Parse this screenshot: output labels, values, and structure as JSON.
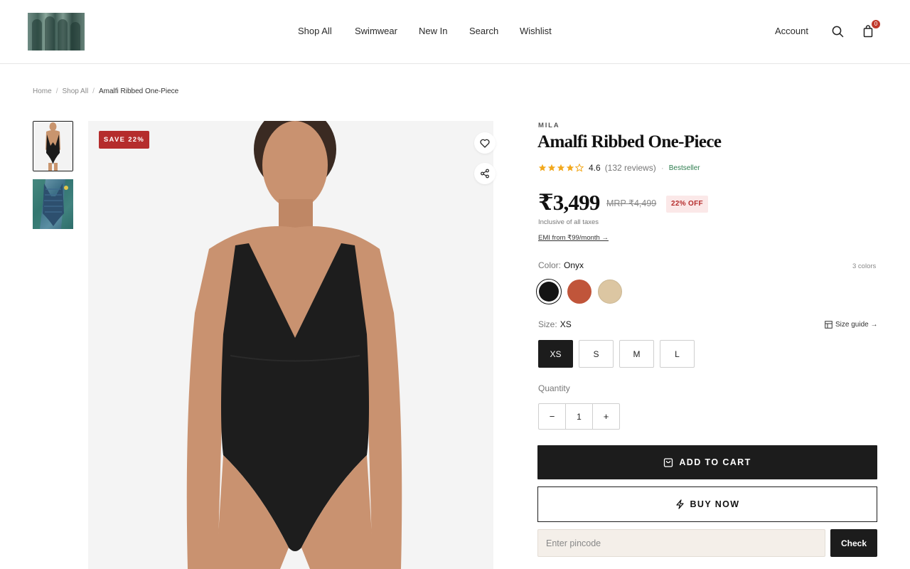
{
  "header": {
    "logo_icon": "swimwear-collection-logo",
    "nav": [
      "Shop All",
      "Swimwear",
      "New In",
      "Search",
      "Wishlist"
    ],
    "account_label": "Account",
    "search_icon": "search-icon",
    "cart_icon": "shopping-bag-icon",
    "cart_count": "0"
  },
  "breadcrumb": {
    "items": [
      "Home",
      "Shop All",
      "Amalfi Ribbed One-Piece"
    ],
    "separator": "/"
  },
  "gallery": {
    "thumbnails": [
      "black one-piece swimsuit front view",
      "blue one-piece swimsuit flat lay"
    ],
    "save_badge": "SAVE 22%",
    "wishlist_icon": "heart-icon",
    "share_icon": "share-icon"
  },
  "product": {
    "brand": "MILA",
    "title": "Amalfi Ribbed One-Piece",
    "rating": 4.6,
    "rating_value": "4.6",
    "reviews": "(132 reviews)",
    "tag": "Bestseller",
    "price": "₹3,499",
    "mrp": "MRP ₹4,499",
    "discount": "22% OFF",
    "taxes_note": "Inclusive of all taxes",
    "emi": "EMI from ₹99/month →",
    "color_label": "Color:",
    "color_value": "Onyx",
    "colors_count": "3 colors",
    "colors": [
      {
        "name": "Onyx",
        "hex": "#141414"
      },
      {
        "name": "Terracotta",
        "hex": "#c0553a"
      },
      {
        "name": "Sand",
        "hex": "#dcc6a2"
      }
    ],
    "size_label": "Size:",
    "size_value": "XS",
    "size_guide": "Size guide →",
    "sizes": [
      "XS",
      "S",
      "M",
      "L"
    ],
    "quantity_label": "Quantity",
    "quantity": "1",
    "add_to_cart": "ADD TO CART",
    "buy_now": "BUY NOW",
    "pincode_placeholder": "Enter pincode",
    "check": "Check"
  }
}
